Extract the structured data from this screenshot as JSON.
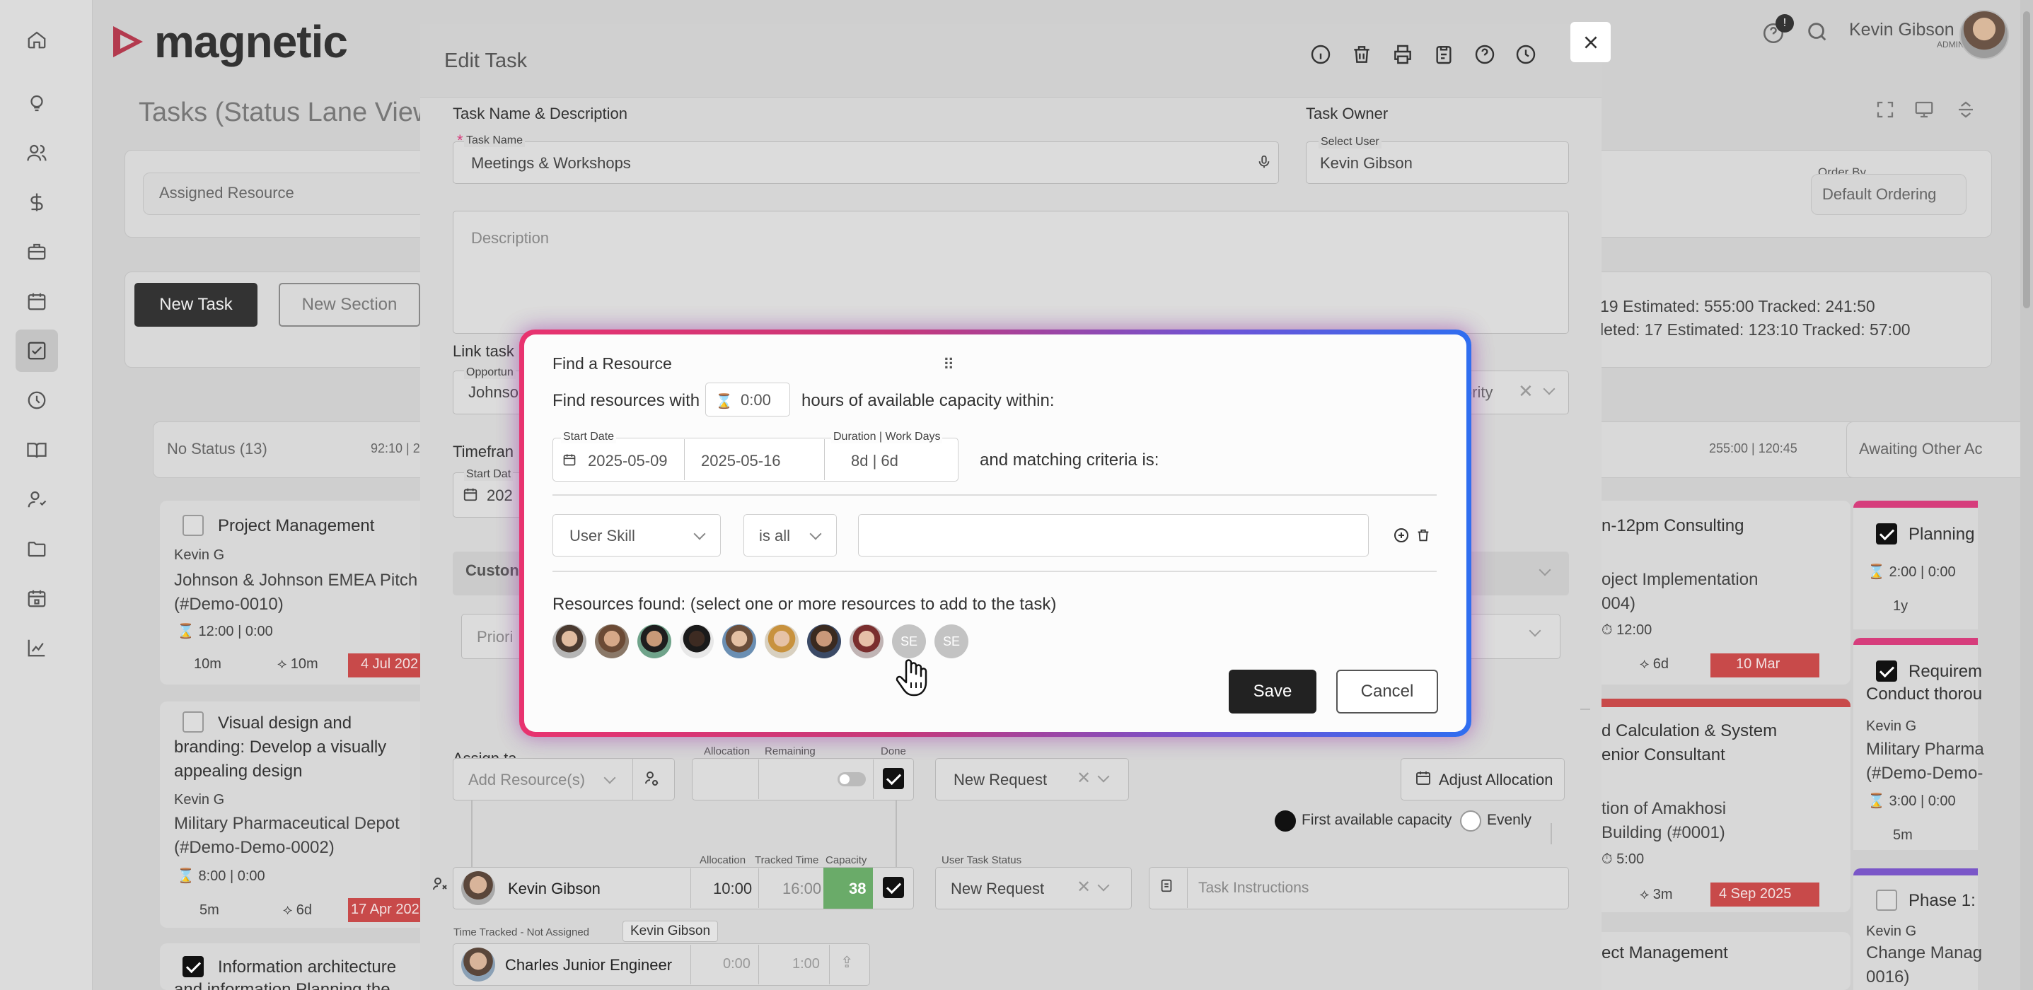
{
  "app": {
    "logo": "magnetic"
  },
  "user": {
    "name": "Kevin Gibson",
    "role": "ADMIN",
    "notification_count": "!"
  },
  "sidebar": {
    "items": [
      {
        "icon": "home-icon"
      },
      {
        "icon": "lightbulb-icon"
      },
      {
        "icon": "users-icon"
      },
      {
        "icon": "dollar-icon"
      },
      {
        "icon": "briefcase-icon"
      },
      {
        "icon": "calendar-icon"
      },
      {
        "icon": "tasks-icon"
      },
      {
        "icon": "clock-icon"
      },
      {
        "icon": "book-icon"
      },
      {
        "icon": "person-icon"
      },
      {
        "icon": "folder-icon"
      },
      {
        "icon": "schedule-icon"
      },
      {
        "icon": "chart-icon"
      }
    ]
  },
  "background": {
    "page_title": "Tasks (Status Lane View)",
    "filter_assigned": "Assigned Resource",
    "order_by_label": "Order By",
    "order_by_value": "Default Ordering",
    "new_task": "New Task",
    "new_section": "New Section",
    "stats_line1": "19    Estimated: 555:00    Tracked: 241:50",
    "stats_line2": "leted: 17    Estimated: 123:10    Tracked: 57:00",
    "lane_no_status": "No Status (13)",
    "lane_no_status_time": "92:10 | 2",
    "lane_right_time": "255:00 | 120:45",
    "lane_awaiting": "Awaiting Other Ac",
    "card1_title": "Project Management",
    "card1_owner": "Kevin G",
    "card1_project": "Johnson & Johnson EMEA Pitch (#Demo-0010)",
    "card1_time": "12:00 | 0:00",
    "card1_est": "10m",
    "card1_track": "10m",
    "card1_date": "4 Jul 202",
    "card2_title": "Visual design and branding: Develop a visually appealing design",
    "card2_owner": "Kevin G",
    "card2_project": "Military Pharmaceutical Depot (#Demo-Demo-0002)",
    "card2_time": "8:00 | 0:00",
    "card2_est": "5m",
    "card2_track": "6d",
    "card2_date": "17 Apr 202",
    "card3_title": "Information architecture",
    "card3_extra": "and information Planning the",
    "rcard1_title": "n-12pm Consulting",
    "rcard1_project": "oject Implementation",
    "rcard1_code": "004)",
    "rcard1_time": "12:00",
    "rcard1_track": "6d",
    "rcard1_date": "10 Mar",
    "rcard2_title": "d Calculation & System",
    "rcard2_sub": "enior Consultant",
    "rcard2_project": "tion of Amakhosi",
    "rcard2_code": "Building (#0001)",
    "rcard2_time": "5:00",
    "rcard2_track": "3m",
    "rcard2_date": "4 Sep 2025",
    "rcard3_title": "ect Management",
    "fcard1_title": "Planning",
    "fcard1_time": "2:00 | 0:00",
    "fcard1_est": "1y",
    "fcard2_title": "Requirem",
    "fcard2_sub": "Conduct thorou",
    "fcard2_owner": "Kevin G",
    "fcard2_project": "Military Pharma",
    "fcard2_code": "(#Demo-Demo-",
    "fcard2_time": "3:00 | 0:00",
    "fcard2_est": "5m",
    "fcard3_title": "Phase 1:",
    "fcard3_owner": "Kevin G",
    "fcard3_project": "Change Manag",
    "fcard3_code": "0016)"
  },
  "edit_task": {
    "title": "Edit Task",
    "section_name": "Task Name & Description",
    "task_name_label": "Task Name",
    "task_name_value": "Meetings & Workshops",
    "section_owner": "Task Owner",
    "select_user_label": "Select User",
    "select_user_value": "Kevin Gibson",
    "description_placeholder": "Description",
    "link_task_label": "Link task",
    "opportunity_label": "Opportun",
    "opportunity_value": "Johnso",
    "priority_value": "iority",
    "timeframe_label": "Timefran",
    "start_date_label": "Start Dat",
    "start_date_value": "202",
    "custom_label": "Custon",
    "priority_placeholder": "Priori",
    "assign_label": "Assign ta",
    "add_resource_placeholder": "Add Resource(s)",
    "allocation_label": "Allocation",
    "remaining_label": "Remaining",
    "done_label": "Done",
    "status_new_request": "New Request",
    "adjust_allocation": "Adjust Allocation",
    "first_available": "First available capacity",
    "evenly": "Evenly",
    "row_allocation_label": "Allocation",
    "row_tracked_label": "Tracked Time",
    "row_capacity_label": "Capacity",
    "user_task_status_label": "User Task Status",
    "resource_name": "Kevin Gibson",
    "resource_allocation": "10:00",
    "resource_tracked": "16:00",
    "resource_capacity": "38",
    "resource_status": "New Request",
    "task_instructions_placeholder": "Task Instructions",
    "time_tracked_label": "Time Tracked - Not Assigned",
    "tooltip_name": "Kevin Gibson",
    "junior_name": "Charles Junior Engineer",
    "junior_allocation": "0:00",
    "junior_tracked": "1:00"
  },
  "find_resource": {
    "title": "Find a Resource",
    "find_prefix": "Find resources with",
    "hours_value": "0:00",
    "find_suffix": "hours of available capacity within:",
    "start_date_label": "Start Date",
    "start_date": "2025-05-09",
    "end_date": "2025-05-16",
    "duration_label": "Duration | Work Days",
    "duration_value": "8d | 6d",
    "matching": "and matching criteria is:",
    "criteria_field": "User Skill",
    "criteria_operator": "is all",
    "resources_found": "Resources found: (select one or more resources to add to the task)",
    "initials_1": "SE",
    "initials_2": "SE",
    "save": "Save",
    "cancel": "Cancel"
  },
  "colors": {
    "accent_green": "#6aab69",
    "date_red": "#c84a4a",
    "pink_bar": "#d63d7c",
    "purple_bar": "#7a56c8"
  }
}
